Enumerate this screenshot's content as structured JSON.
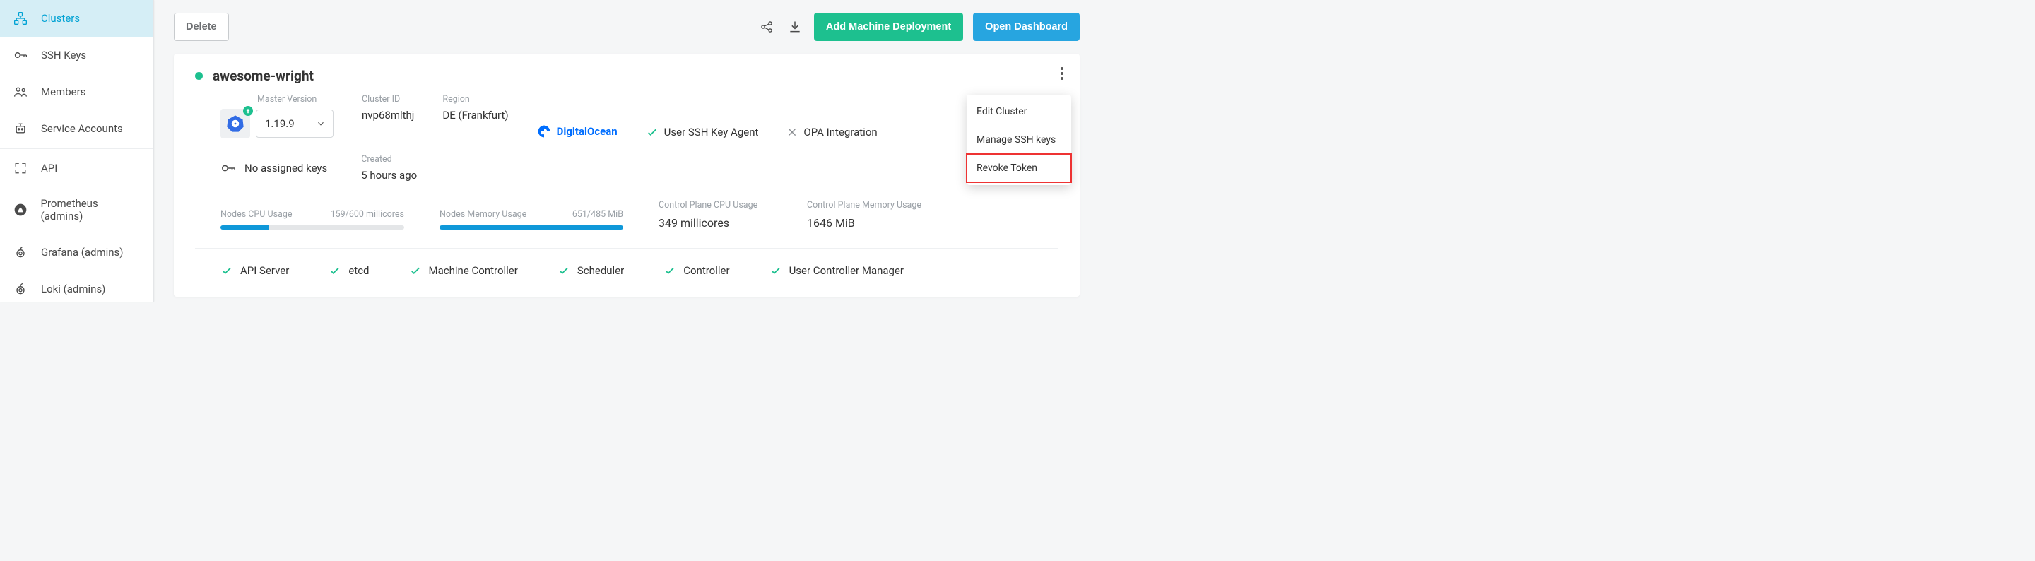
{
  "sidebar": {
    "items": [
      {
        "label": "Clusters"
      },
      {
        "label": "SSH Keys"
      },
      {
        "label": "Members"
      },
      {
        "label": "Service Accounts"
      },
      {
        "label": "API"
      },
      {
        "label": "Prometheus (admins)"
      },
      {
        "label": "Grafana (admins)"
      },
      {
        "label": "Loki (admins)"
      }
    ]
  },
  "toolbar": {
    "delete_label": "Delete",
    "add_deployment_label": "Add Machine Deployment",
    "open_dashboard_label": "Open Dashboard"
  },
  "cluster": {
    "name": "awesome-wright",
    "master_version_label": "Master Version",
    "master_version": "1.19.9",
    "cluster_id_label": "Cluster ID",
    "cluster_id": "nvp68mlthj",
    "region_label": "Region",
    "region": "DE (Frankfurt)",
    "provider": "DigitalOcean",
    "ssh_agent": "User SSH Key Agent",
    "opa": "OPA Integration",
    "keys_label": "No assigned keys",
    "created_label": "Created",
    "created": "5 hours ago"
  },
  "metrics": {
    "nodes_cpu_label": "Nodes CPU Usage",
    "nodes_cpu_value": "159/600 millicores",
    "nodes_cpu_pct": 26,
    "nodes_mem_label": "Nodes Memory Usage",
    "nodes_mem_value": "651/485 MiB",
    "nodes_mem_pct": 100,
    "cp_cpu_label": "Control Plane CPU Usage",
    "cp_cpu_value": "349 millicores",
    "cp_mem_label": "Control Plane Memory Usage",
    "cp_mem_value": "1646 MiB"
  },
  "components": [
    "API Server",
    "etcd",
    "Machine Controller",
    "Scheduler",
    "Controller",
    "User Controller Manager"
  ],
  "menu": {
    "edit": "Edit Cluster",
    "ssh": "Manage SSH keys",
    "revoke": "Revoke Token"
  }
}
